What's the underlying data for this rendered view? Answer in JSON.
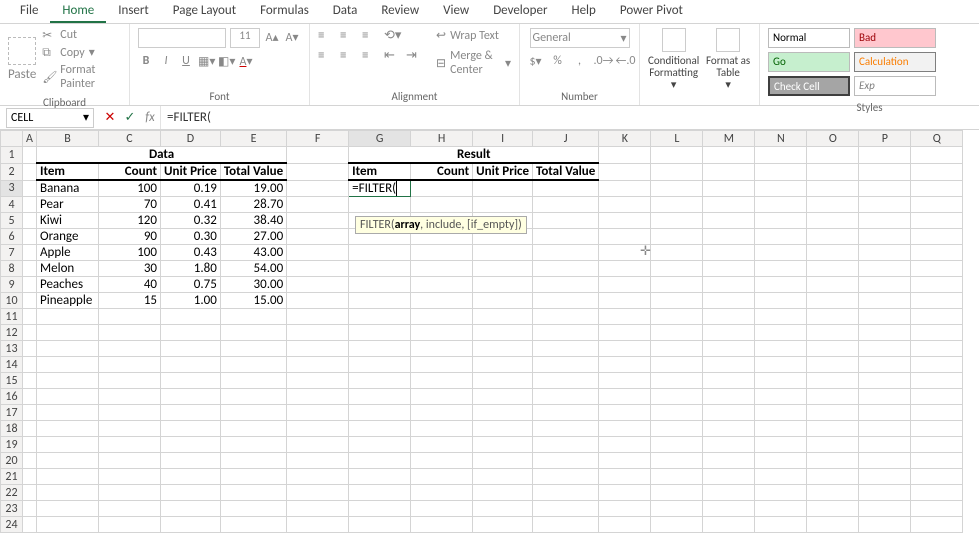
{
  "tabs": [
    "File",
    "Home",
    "Insert",
    "Page Layout",
    "Formulas",
    "Data",
    "Review",
    "View",
    "Developer",
    "Help",
    "Power Pivot"
  ],
  "active_tab_index": 1,
  "clipboard": {
    "paste": "Paste",
    "cut": "Cut",
    "copy": "Copy",
    "painter": "Format Painter",
    "label": "Clipboard"
  },
  "font": {
    "name": "",
    "size": "11",
    "label": "Font"
  },
  "alignment": {
    "wrap": "Wrap Text",
    "merge": "Merge & Center",
    "label": "Alignment"
  },
  "number": {
    "format": "General",
    "label": "Number"
  },
  "styles_btns": {
    "conditional": "Conditional Formatting",
    "table": "Format as Table"
  },
  "styles": {
    "normal": "Normal",
    "bad": "Bad",
    "good": "Go",
    "calc": "Calculation",
    "check": "Check Cell",
    "exp": "Exp",
    "label": "Styles"
  },
  "formula_bar": {
    "name_box": "CELL",
    "cancel": "✕",
    "enter": "✓",
    "fx": "fx",
    "formula": "=FILTER("
  },
  "columns": [
    "A",
    "B",
    "C",
    "D",
    "E",
    "F",
    "G",
    "H",
    "I",
    "J",
    "K",
    "L",
    "M",
    "N",
    "O",
    "P",
    "Q"
  ],
  "sheet": {
    "data_header": "Data",
    "result_header": "Result",
    "item_h": "Item",
    "count_h": "Count",
    "price_h": "Unit Price",
    "total_h": "Total Value",
    "rows": [
      {
        "item": "Banana",
        "count": "100",
        "price": "0.19",
        "total": "19.00"
      },
      {
        "item": "Pear",
        "count": "70",
        "price": "0.41",
        "total": "28.70"
      },
      {
        "item": "Kiwi",
        "count": "120",
        "price": "0.32",
        "total": "38.40"
      },
      {
        "item": "Orange",
        "count": "90",
        "price": "0.30",
        "total": "27.00"
      },
      {
        "item": "Apple",
        "count": "100",
        "price": "0.43",
        "total": "43.00"
      },
      {
        "item": "Melon",
        "count": "30",
        "price": "1.80",
        "total": "54.00"
      },
      {
        "item": "Peaches",
        "count": "40",
        "price": "0.75",
        "total": "30.00"
      },
      {
        "item": "Pineapple",
        "count": "15",
        "price": "1.00",
        "total": "15.00"
      }
    ],
    "editing": "=FILTER("
  },
  "tooltip": {
    "prefix": "FILTER(",
    "arg1": "array",
    "rest": ", include, [if_empty])"
  }
}
